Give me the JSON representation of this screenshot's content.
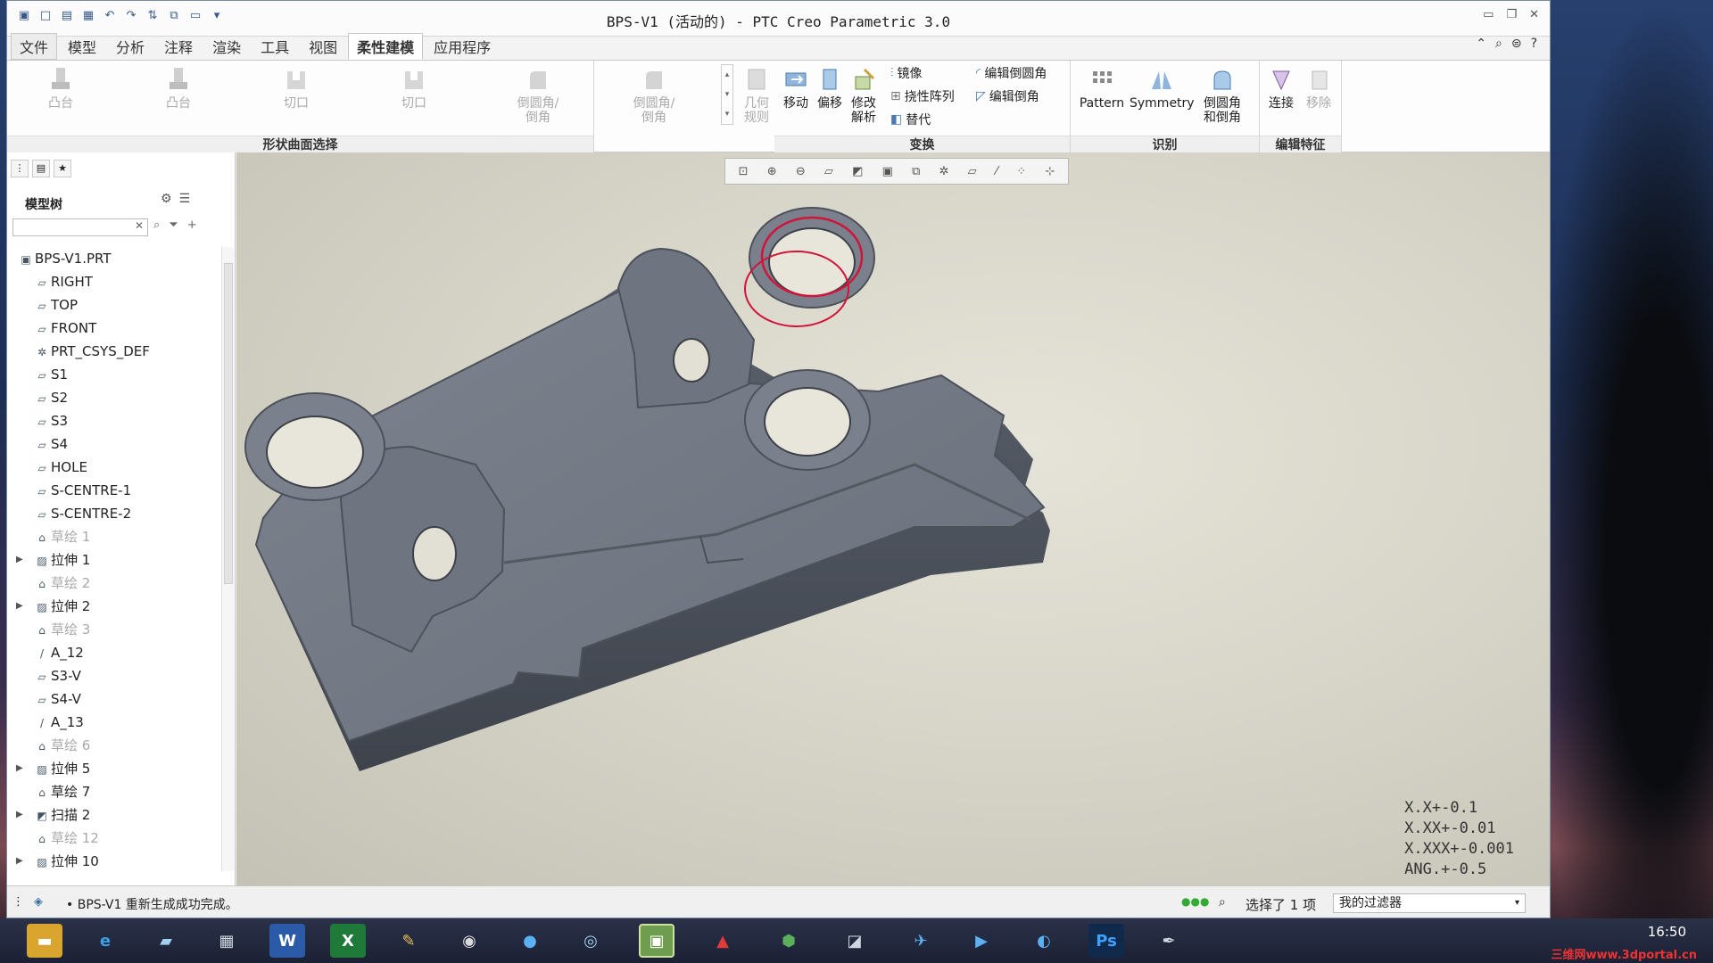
{
  "window": {
    "title": "BPS-V1 (活动的) - PTC Creo Parametric 3.0"
  },
  "menu": [
    "文件",
    "模型",
    "分析",
    "注释",
    "渲染",
    "工具",
    "视图",
    "柔性建模",
    "应用程序"
  ],
  "ribbon": {
    "shape": {
      "label": "形状曲面选择",
      "buttons": [
        "凸台",
        "凸台",
        "切口",
        "切口",
        "倒圆角/\n倒角",
        "倒圆角/\n倒角"
      ]
    },
    "geom_rule": "几何\n规则",
    "transform": {
      "label": "变换",
      "move": "移动",
      "offset": "偏移",
      "modify": "修改\n解析",
      "mirror": "镜像",
      "flex_pattern": "挠性阵列",
      "substitute": "替代",
      "edit_round": "编辑倒圆角",
      "edit_chamfer": "编辑倒角"
    },
    "recognize": {
      "label": "识别",
      "pattern": "Pattern",
      "symmetry": "Symmetry",
      "round_chamfer": "倒圆角\n和倒角"
    },
    "edit_feature": {
      "label": "编辑特征",
      "attach": "连接",
      "remove": "移除"
    }
  },
  "model_tree": {
    "title": "模型树",
    "items": [
      {
        "label": "BPS-V1.PRT",
        "icon": "part-icon",
        "dim": false,
        "expand": false,
        "indent": 0
      },
      {
        "label": "RIGHT",
        "icon": "plane-icon",
        "dim": false,
        "expand": false,
        "indent": 1
      },
      {
        "label": "TOP",
        "icon": "plane-icon",
        "dim": false,
        "expand": false,
        "indent": 1
      },
      {
        "label": "FRONT",
        "icon": "plane-icon",
        "dim": false,
        "expand": false,
        "indent": 1
      },
      {
        "label": "PRT_CSYS_DEF",
        "icon": "csys-icon",
        "dim": false,
        "expand": false,
        "indent": 1
      },
      {
        "label": "S1",
        "icon": "plane-icon",
        "dim": false,
        "expand": false,
        "indent": 1
      },
      {
        "label": "S2",
        "icon": "plane-icon",
        "dim": false,
        "expand": false,
        "indent": 1
      },
      {
        "label": "S3",
        "icon": "plane-icon",
        "dim": false,
        "expand": false,
        "indent": 1
      },
      {
        "label": "S4",
        "icon": "plane-icon",
        "dim": false,
        "expand": false,
        "indent": 1
      },
      {
        "label": "HOLE",
        "icon": "plane-icon",
        "dim": false,
        "expand": false,
        "indent": 1
      },
      {
        "label": "S-CENTRE-1",
        "icon": "plane-icon",
        "dim": false,
        "expand": false,
        "indent": 1
      },
      {
        "label": "S-CENTRE-2",
        "icon": "plane-icon",
        "dim": false,
        "expand": false,
        "indent": 1
      },
      {
        "label": "草绘 1",
        "icon": "sketch-icon",
        "dim": true,
        "expand": false,
        "indent": 1
      },
      {
        "label": "拉伸 1",
        "icon": "extrude-icon",
        "dim": false,
        "expand": true,
        "indent": 1
      },
      {
        "label": "草绘 2",
        "icon": "sketch-icon",
        "dim": true,
        "expand": false,
        "indent": 1
      },
      {
        "label": "拉伸 2",
        "icon": "extrude-icon",
        "dim": false,
        "expand": true,
        "indent": 1
      },
      {
        "label": "草绘 3",
        "icon": "sketch-icon",
        "dim": true,
        "expand": false,
        "indent": 1
      },
      {
        "label": "A_12",
        "icon": "axis-icon",
        "dim": false,
        "expand": false,
        "indent": 1
      },
      {
        "label": "S3-V",
        "icon": "plane-icon",
        "dim": false,
        "expand": false,
        "indent": 1
      },
      {
        "label": "S4-V",
        "icon": "plane-icon",
        "dim": false,
        "expand": false,
        "indent": 1
      },
      {
        "label": "A_13",
        "icon": "axis-icon",
        "dim": false,
        "expand": false,
        "indent": 1
      },
      {
        "label": "草绘 6",
        "icon": "sketch-icon",
        "dim": true,
        "expand": false,
        "indent": 1
      },
      {
        "label": "拉伸 5",
        "icon": "extrude-icon",
        "dim": false,
        "expand": true,
        "indent": 1
      },
      {
        "label": "草绘 7",
        "icon": "sketch-icon",
        "dim": false,
        "expand": false,
        "indent": 1
      },
      {
        "label": "扫描 2",
        "icon": "sweep-icon",
        "dim": false,
        "expand": true,
        "indent": 1
      },
      {
        "label": "草绘 12",
        "icon": "sketch-icon",
        "dim": true,
        "expand": false,
        "indent": 1
      },
      {
        "label": "拉伸 10",
        "icon": "extrude-icon",
        "dim": false,
        "expand": true,
        "indent": 1
      }
    ]
  },
  "tolerance": [
    "X.X+-0.1",
    "X.XX+-0.01",
    "X.XXX+-0.001",
    "ANG.+-0.5"
  ],
  "status": {
    "message": "• BPS-V1 重新生成成功完成。",
    "selected": "选择了 1 项",
    "filter": "我的过滤器"
  },
  "taskbar": {
    "time": "16:50",
    "watermark": "三维网www.3dportal.cn"
  }
}
